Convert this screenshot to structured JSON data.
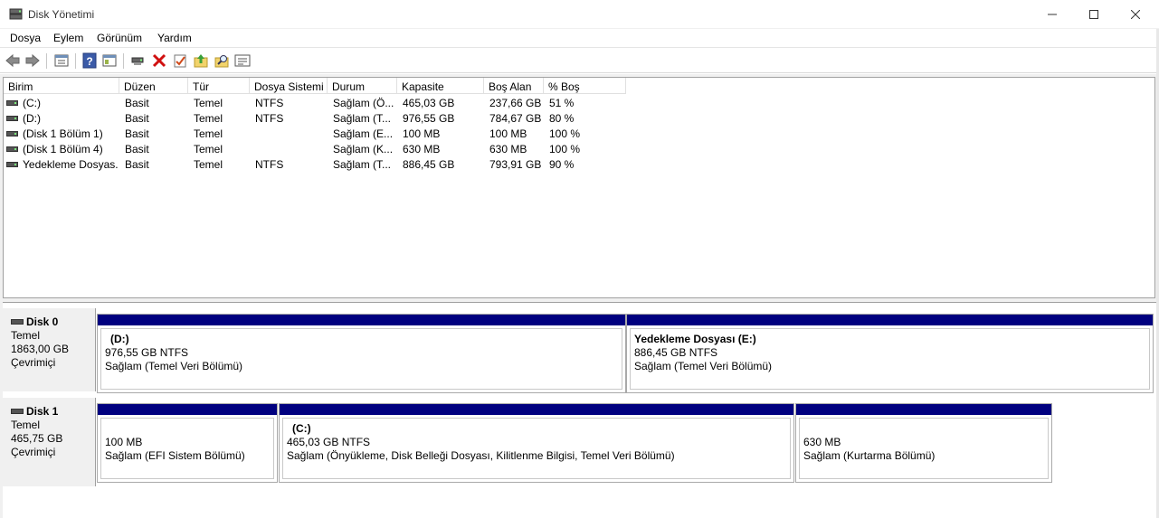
{
  "window": {
    "title": "Disk Yönetimi"
  },
  "menu": [
    "Dosya",
    "Eylem",
    "Görünüm",
    "Yardım"
  ],
  "toolbar": {
    "icons": [
      "back-arrow-icon",
      "forward-arrow-icon",
      "properties-icon",
      "help-icon",
      "console-tree-icon",
      "connect-icon",
      "delete-icon",
      "check-icon",
      "up-folder-icon",
      "search-folder-icon",
      "list-view-icon"
    ]
  },
  "volume_list": {
    "columns": [
      "Birim",
      "Düzen",
      "Tür",
      "Dosya Sistemi",
      "Durum",
      "Kapasite",
      "Boş Alan",
      "% Boş"
    ],
    "rows": [
      [
        "(C:)",
        "Basit",
        "Temel",
        "NTFS",
        "Sağlam (Ö...",
        "465,03 GB",
        "237,66 GB",
        "51 %"
      ],
      [
        "(D:)",
        "Basit",
        "Temel",
        "NTFS",
        "Sağlam (T...",
        "976,55 GB",
        "784,67 GB",
        "80 %"
      ],
      [
        "(Disk 1 Bölüm 1)",
        "Basit",
        "Temel",
        "",
        "Sağlam (E...",
        "100 MB",
        "100 MB",
        "100 %"
      ],
      [
        "(Disk 1 Bölüm 4)",
        "Basit",
        "Temel",
        "",
        "Sağlam (K...",
        "630 MB",
        "630 MB",
        "100 %"
      ],
      [
        "Yedekleme Dosyas...",
        "Basit",
        "Temel",
        "NTFS",
        "Sağlam (T...",
        "886,45 GB",
        "793,91 GB",
        "90 %"
      ]
    ]
  },
  "disks": [
    {
      "name": "Disk 0",
      "type": "Temel",
      "size": "1863,00 GB",
      "status": "Çevrimiçi",
      "partitions": [
        {
          "title": "(D:)",
          "size": "976,55 GB NTFS",
          "status": "Sağlam (Temel Veri Bölümü)"
        },
        {
          "title": "Yedekleme Dosyası  (E:)",
          "size": "886,45 GB NTFS",
          "status": "Sağlam (Temel Veri Bölümü)"
        }
      ]
    },
    {
      "name": "Disk 1",
      "type": "Temel",
      "size": "465,75 GB",
      "status": "Çevrimiçi",
      "partitions": [
        {
          "title": "",
          "size": "100 MB",
          "status": "Sağlam (EFI Sistem Bölümü)"
        },
        {
          "title": "(C:)",
          "size": "465,03 GB NTFS",
          "status": "Sağlam (Önyükleme, Disk Belleği Dosyası, Kilitlenme Bilgisi, Temel Veri Bölümü)"
        },
        {
          "title": "",
          "size": "630 MB",
          "status": "Sağlam (Kurtarma Bölümü)"
        }
      ]
    }
  ]
}
